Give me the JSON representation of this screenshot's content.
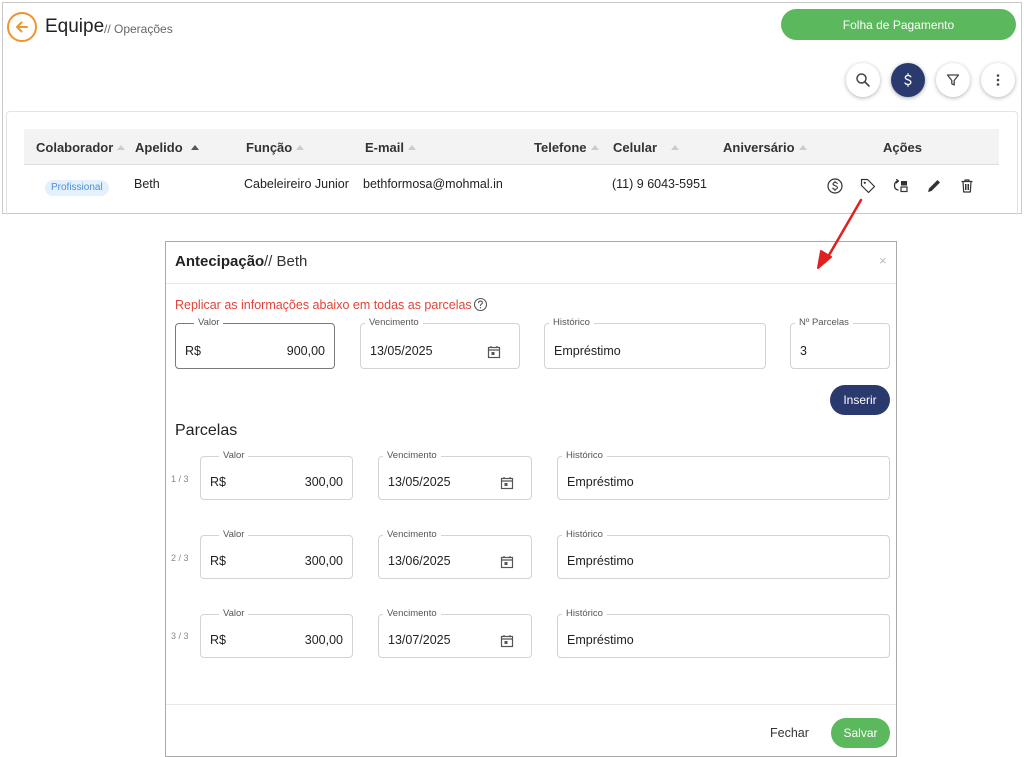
{
  "header": {
    "title": "Equipe",
    "subtitle": "// Operações",
    "payroll_button": "Folha de Pagamento"
  },
  "table": {
    "columns": [
      "Colaborador",
      "Apelido",
      "Função",
      "E-mail",
      "Telefone",
      "Celular",
      "Aniversário",
      "Ações"
    ],
    "row": {
      "badge": "Profissional",
      "apelido": "Beth",
      "funcao": "Cabeleireiro Junior",
      "email": "bethformosa@mohmal.in",
      "telefone": "",
      "celular": "(11) 9 6043-5951",
      "aniversario": ""
    }
  },
  "modal": {
    "title": "Antecipação",
    "title_suffix": "// Beth",
    "close_symbol": "×",
    "replicate_note": "Replicar as informações abaixo em todas as parcelas",
    "main": {
      "valor_label": "Valor",
      "currency": "R$",
      "valor": "900,00",
      "vencimento_label": "Vencimento",
      "vencimento": "13/05/2025",
      "historico_label": "Histórico",
      "historico": "Empréstimo",
      "parcelas_label": "Nº Parcelas",
      "parcelas": "3"
    },
    "insert_button": "Inserir",
    "parcelas_heading": "Parcelas",
    "installments": [
      {
        "index": "1 / 3",
        "valor_label": "Valor",
        "currency": "R$",
        "valor": "300,00",
        "vencimento_label": "Vencimento",
        "vencimento": "13/05/2025",
        "historico_label": "Histórico",
        "historico": "Empréstimo"
      },
      {
        "index": "2 / 3",
        "valor_label": "Valor",
        "currency": "R$",
        "valor": "300,00",
        "vencimento_label": "Vencimento",
        "vencimento": "13/06/2025",
        "historico_label": "Histórico",
        "historico": "Empréstimo"
      },
      {
        "index": "3 / 3",
        "valor_label": "Valor",
        "currency": "R$",
        "valor": "300,00",
        "vencimento_label": "Vencimento",
        "vencimento": "13/07/2025",
        "historico_label": "Histórico",
        "historico": "Empréstimo"
      }
    ],
    "close_button": "Fechar",
    "save_button": "Salvar"
  },
  "colors": {
    "accent_orange": "#f0942b",
    "green": "#5cb85c",
    "navy": "#2a3a6e",
    "note_red": "#e0443a",
    "arrow_red": "#e02020"
  },
  "icons": {
    "back": "arrow-left-icon",
    "search": "search-icon",
    "money": "dollar-icon",
    "filter": "filter-icon",
    "more": "more-vertical-icon",
    "actions": [
      "dollar-circle-icon",
      "tag-icon",
      "transfer-icon",
      "pencil-icon",
      "trash-icon"
    ],
    "calendar": "calendar-icon",
    "help": "help-circle-icon"
  }
}
